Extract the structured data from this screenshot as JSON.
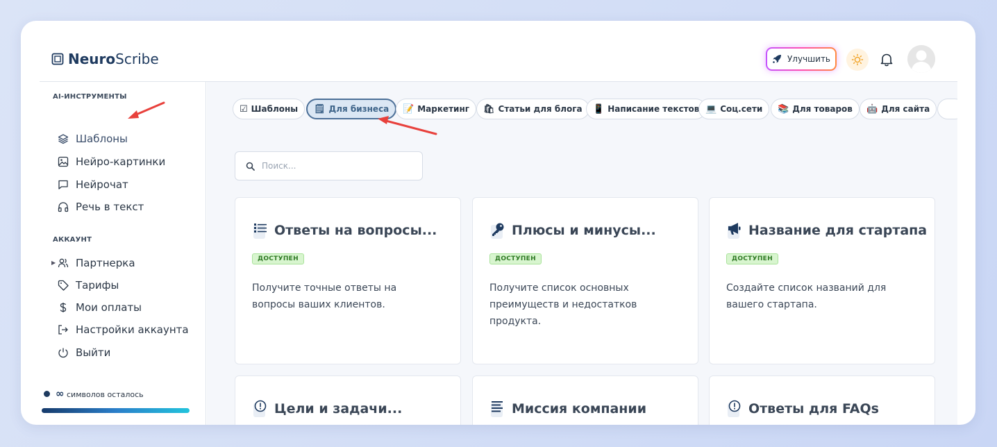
{
  "app": {
    "name_bold": "Neuro",
    "name_rest": "Scribe"
  },
  "header": {
    "upgrade_label": "Улучшить",
    "icons": {
      "upgrade": "rocket-icon",
      "theme": "sun-icon",
      "notifications": "bell-icon",
      "avatar": "user-avatar"
    }
  },
  "sidebar": {
    "section_tools": "AI-ИНСТРУМЕНТЫ",
    "tools": [
      {
        "label": "Шаблоны",
        "icon": "layers-icon",
        "active": true
      },
      {
        "label": "Нейро-картинки",
        "icon": "image-icon"
      },
      {
        "label": "Нейрочат",
        "icon": "chat-icon"
      },
      {
        "label": "Речь в текст",
        "icon": "headphones-icon"
      }
    ],
    "section_account": "АККАУНТ",
    "account": [
      {
        "label": "Партнерка",
        "icon": "users-icon"
      },
      {
        "label": "Тарифы",
        "icon": "tag-icon"
      },
      {
        "label": "Мои оплаты",
        "icon": "dollar-icon"
      },
      {
        "label": "Настройки аккаунта",
        "icon": "logout-arrow-icon"
      },
      {
        "label": "Выйти",
        "icon": "power-icon"
      }
    ],
    "credits_symbol": "∞",
    "credits_label": "символов осталось"
  },
  "categories": [
    {
      "label": "Шаблоны",
      "emoji": "☑"
    },
    {
      "label": "Для бизнеса",
      "emoji": "🗒",
      "active": true
    },
    {
      "label": "Маркетинг",
      "emoji": "📝"
    },
    {
      "label": "Статьи для блога",
      "emoji": "🛍"
    },
    {
      "label": "Написание текстов",
      "emoji": "📱"
    },
    {
      "label": "Соц.сети",
      "emoji": "💻"
    },
    {
      "label": "Для товаров",
      "emoji": "📚"
    },
    {
      "label": "Для сайта",
      "emoji": "🤖"
    }
  ],
  "search": {
    "placeholder": "Поиск..."
  },
  "cards": [
    {
      "title": "Ответы на вопросы...",
      "badge": "ДОСТУПЕН",
      "desc": "Получите точные ответы на вопросы ваших клиентов.",
      "icon": "list-icon"
    },
    {
      "title": "Плюсы и минусы...",
      "badge": "ДОСТУПЕН",
      "desc": "Получите список основных преимуществ и недостатков продукта.",
      "icon": "key-icon"
    },
    {
      "title": "Название для стартапа",
      "badge": "ДОСТУПЕН",
      "desc": "Создайте список названий для вашего стартапа.",
      "icon": "megaphone-icon"
    },
    {
      "title": "Цели и задачи...",
      "icon": "alert-icon"
    },
    {
      "title": "Миссия компании",
      "icon": "text-lines-icon"
    },
    {
      "title": "Ответы для FAQs",
      "icon": "alert-icon"
    }
  ],
  "colors": {
    "brand": "#1e3a5f",
    "badge_bg": "#d8f5cf",
    "annotation_arrow": "#e8413c"
  }
}
